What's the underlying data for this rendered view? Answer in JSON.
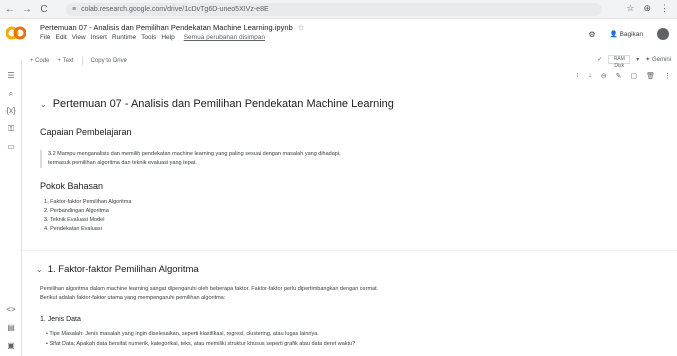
{
  "browser": {
    "url": "colab.research.google.com/drive/1cDvTg6D-uneo5XIVz-e8E",
    "nav": [
      "←",
      "→",
      "C"
    ],
    "icons": [
      "☆",
      "⊕",
      "⋮"
    ]
  },
  "header": {
    "title": "Pertemuan 07 - Analisis dan Pemilihan Pendekatan Machine Learning.ipynb",
    "star": "☆",
    "menu": [
      "File",
      "Edit",
      "View",
      "Insert",
      "Runtime",
      "Tools",
      "Help"
    ],
    "saved_status": "Semua perubahan disimpan",
    "share_label": "Bagikan"
  },
  "toolbar": {
    "code": "+ Code",
    "text": "+ Text",
    "copy": "Copy to Drive",
    "ram": "RAM\nDisk",
    "gemini": "Gemini"
  },
  "notebook": {
    "title": "Pertemuan 07 - Analisis dan Pemilihan Pendekatan Machine Learning",
    "section1": "Capaian Pembelajaran",
    "quote_line1": "3.2 Mampu menganalisis dan memilih pendekatan machine learning yang paling sesuai dengan masalah yang dihadapi,",
    "quote_line2": "termasuk pemilihan algoritma dan teknik evaluasi yang tepat.",
    "section2": "Pokok Bahasan",
    "topics": [
      "1. Faktor-faktor Pemilihan Algoritma",
      "2. Perbandingan Algoritma",
      "3. Teknik Evaluasi Model",
      "4. Pendekatan Evaluasi"
    ],
    "section3": "1. Faktor-faktor Pemilihan Algoritma",
    "para_line1": "Pemilihan algoritma dalam machine learning sangat dipengaruhi oleh beberapa faktor. Faktor-faktor perlu dipertimbangkan dengan cermat.",
    "para_line2": "Berikut adalah faktor-faktor utama yang mempengaruhi pemilihan algoritma:",
    "subsection": "1. Jenis Data",
    "bullets": [
      "Tipe Masalah: Jenis masalah yang ingin diselesaikan, seperti klasifikasi, regresi, clustering, atau lugas lainnya.",
      "Sifat Data: Apakah data bersifat numerik, kategorikal, teks, atau memiliki struktur khusus seperti grafik atau data deret waktu?"
    ]
  }
}
